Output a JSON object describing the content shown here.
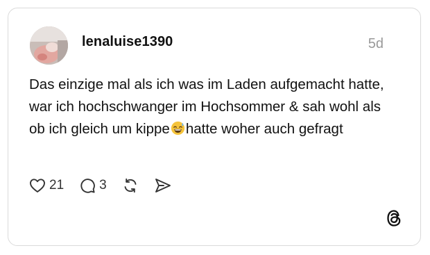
{
  "post": {
    "username": "lenaluise1390",
    "timestamp": "5d",
    "text_part1": "Das einzige mal als ich was im Laden aufgemacht hatte, war ich hochschwanger im Hochsommer & sah wohl als ob ich gleich um kippe",
    "emoji": "grinning-face-with-sweat",
    "text_part2": "hatte woher auch gefragt",
    "like_count": "21",
    "reply_count": "3"
  },
  "icons": {
    "like": "heart-icon",
    "reply": "speech-bubble-icon",
    "repost": "repost-icon",
    "share": "send-icon",
    "brand": "threads-logo-icon"
  },
  "colors": {
    "border": "#dadada",
    "text": "#111111",
    "muted": "#999999",
    "emoji": "#f5c33b"
  }
}
